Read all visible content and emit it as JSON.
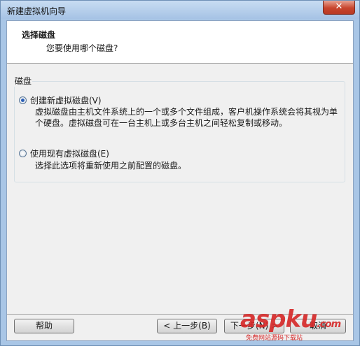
{
  "window": {
    "title": "新建虚拟机向导",
    "close_label": "✕"
  },
  "header": {
    "title": "选择磁盘",
    "subtitle": "您要使用哪个磁盘?"
  },
  "disk_group": {
    "legend": "磁盘",
    "options": [
      {
        "label": "创建新虚拟磁盘(V)",
        "checked": true,
        "desc_line1": "虚拟磁盘由主机文件系统上的一个或多个文件组成，客户机操作系统会将其视为单",
        "desc_line2": "个硬盘。虚拟磁盘可在一台主机上或多台主机之间轻松复制或移动。"
      },
      {
        "label": "使用现有虚拟磁盘(E)",
        "checked": false,
        "desc_line1": "选择此选项将重新使用之前配置的磁盘。"
      }
    ]
  },
  "buttons": {
    "help": "帮助",
    "back": "< 上一步(B)",
    "next": "下一步(N) >",
    "cancel": "取消"
  },
  "watermark": {
    "text": "aspku",
    "suffix": ".com",
    "sub": "免费网站源码下载站"
  }
}
